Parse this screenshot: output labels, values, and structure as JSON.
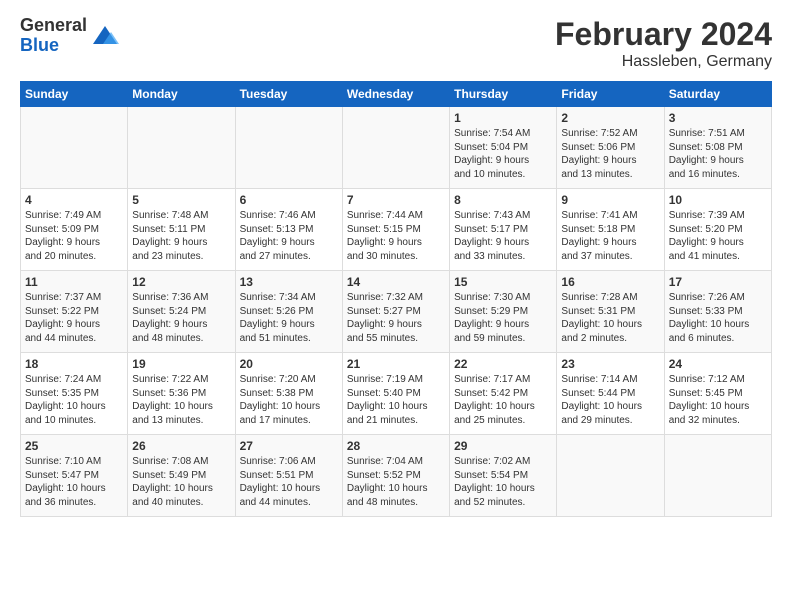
{
  "logo": {
    "general": "General",
    "blue": "Blue"
  },
  "header": {
    "month_year": "February 2024",
    "location": "Hassleben, Germany"
  },
  "days_of_week": [
    "Sunday",
    "Monday",
    "Tuesday",
    "Wednesday",
    "Thursday",
    "Friday",
    "Saturday"
  ],
  "weeks": [
    [
      {
        "day": "",
        "info": ""
      },
      {
        "day": "",
        "info": ""
      },
      {
        "day": "",
        "info": ""
      },
      {
        "day": "",
        "info": ""
      },
      {
        "day": "1",
        "info": "Sunrise: 7:54 AM\nSunset: 5:04 PM\nDaylight: 9 hours\nand 10 minutes."
      },
      {
        "day": "2",
        "info": "Sunrise: 7:52 AM\nSunset: 5:06 PM\nDaylight: 9 hours\nand 13 minutes."
      },
      {
        "day": "3",
        "info": "Sunrise: 7:51 AM\nSunset: 5:08 PM\nDaylight: 9 hours\nand 16 minutes."
      }
    ],
    [
      {
        "day": "4",
        "info": "Sunrise: 7:49 AM\nSunset: 5:09 PM\nDaylight: 9 hours\nand 20 minutes."
      },
      {
        "day": "5",
        "info": "Sunrise: 7:48 AM\nSunset: 5:11 PM\nDaylight: 9 hours\nand 23 minutes."
      },
      {
        "day": "6",
        "info": "Sunrise: 7:46 AM\nSunset: 5:13 PM\nDaylight: 9 hours\nand 27 minutes."
      },
      {
        "day": "7",
        "info": "Sunrise: 7:44 AM\nSunset: 5:15 PM\nDaylight: 9 hours\nand 30 minutes."
      },
      {
        "day": "8",
        "info": "Sunrise: 7:43 AM\nSunset: 5:17 PM\nDaylight: 9 hours\nand 33 minutes."
      },
      {
        "day": "9",
        "info": "Sunrise: 7:41 AM\nSunset: 5:18 PM\nDaylight: 9 hours\nand 37 minutes."
      },
      {
        "day": "10",
        "info": "Sunrise: 7:39 AM\nSunset: 5:20 PM\nDaylight: 9 hours\nand 41 minutes."
      }
    ],
    [
      {
        "day": "11",
        "info": "Sunrise: 7:37 AM\nSunset: 5:22 PM\nDaylight: 9 hours\nand 44 minutes."
      },
      {
        "day": "12",
        "info": "Sunrise: 7:36 AM\nSunset: 5:24 PM\nDaylight: 9 hours\nand 48 minutes."
      },
      {
        "day": "13",
        "info": "Sunrise: 7:34 AM\nSunset: 5:26 PM\nDaylight: 9 hours\nand 51 minutes."
      },
      {
        "day": "14",
        "info": "Sunrise: 7:32 AM\nSunset: 5:27 PM\nDaylight: 9 hours\nand 55 minutes."
      },
      {
        "day": "15",
        "info": "Sunrise: 7:30 AM\nSunset: 5:29 PM\nDaylight: 9 hours\nand 59 minutes."
      },
      {
        "day": "16",
        "info": "Sunrise: 7:28 AM\nSunset: 5:31 PM\nDaylight: 10 hours\nand 2 minutes."
      },
      {
        "day": "17",
        "info": "Sunrise: 7:26 AM\nSunset: 5:33 PM\nDaylight: 10 hours\nand 6 minutes."
      }
    ],
    [
      {
        "day": "18",
        "info": "Sunrise: 7:24 AM\nSunset: 5:35 PM\nDaylight: 10 hours\nand 10 minutes."
      },
      {
        "day": "19",
        "info": "Sunrise: 7:22 AM\nSunset: 5:36 PM\nDaylight: 10 hours\nand 13 minutes."
      },
      {
        "day": "20",
        "info": "Sunrise: 7:20 AM\nSunset: 5:38 PM\nDaylight: 10 hours\nand 17 minutes."
      },
      {
        "day": "21",
        "info": "Sunrise: 7:19 AM\nSunset: 5:40 PM\nDaylight: 10 hours\nand 21 minutes."
      },
      {
        "day": "22",
        "info": "Sunrise: 7:17 AM\nSunset: 5:42 PM\nDaylight: 10 hours\nand 25 minutes."
      },
      {
        "day": "23",
        "info": "Sunrise: 7:14 AM\nSunset: 5:44 PM\nDaylight: 10 hours\nand 29 minutes."
      },
      {
        "day": "24",
        "info": "Sunrise: 7:12 AM\nSunset: 5:45 PM\nDaylight: 10 hours\nand 32 minutes."
      }
    ],
    [
      {
        "day": "25",
        "info": "Sunrise: 7:10 AM\nSunset: 5:47 PM\nDaylight: 10 hours\nand 36 minutes."
      },
      {
        "day": "26",
        "info": "Sunrise: 7:08 AM\nSunset: 5:49 PM\nDaylight: 10 hours\nand 40 minutes."
      },
      {
        "day": "27",
        "info": "Sunrise: 7:06 AM\nSunset: 5:51 PM\nDaylight: 10 hours\nand 44 minutes."
      },
      {
        "day": "28",
        "info": "Sunrise: 7:04 AM\nSunset: 5:52 PM\nDaylight: 10 hours\nand 48 minutes."
      },
      {
        "day": "29",
        "info": "Sunrise: 7:02 AM\nSunset: 5:54 PM\nDaylight: 10 hours\nand 52 minutes."
      },
      {
        "day": "",
        "info": ""
      },
      {
        "day": "",
        "info": ""
      }
    ]
  ]
}
